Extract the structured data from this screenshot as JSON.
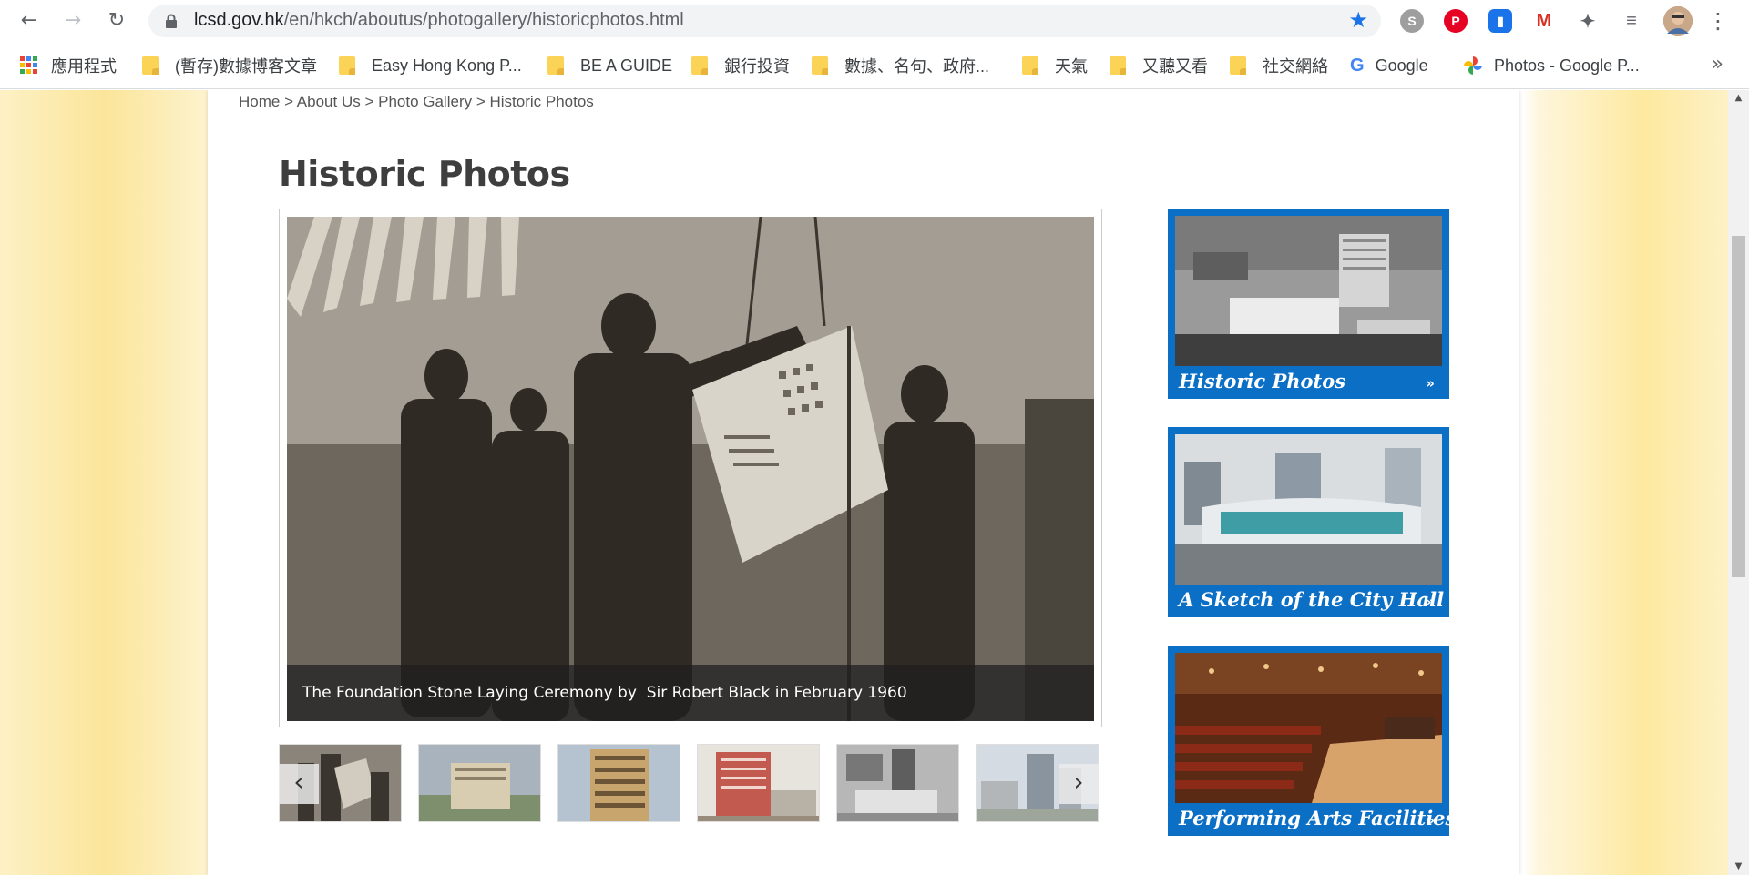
{
  "browser": {
    "url_host": "lcsd.gov.hk",
    "url_path": "/en/hkch/aboutus/photogallery/historicphotos.html",
    "bookmarks": [
      {
        "label": "應用程式",
        "icon": "apps-grid-icon"
      },
      {
        "label": "(暫存)數據博客文章",
        "icon": "folder-icon"
      },
      {
        "label": "Easy Hong Kong P...",
        "icon": "folder-icon"
      },
      {
        "label": "BE A GUIDE",
        "icon": "folder-icon"
      },
      {
        "label": "銀行投資",
        "icon": "folder-icon"
      },
      {
        "label": "數據、名句、政府...",
        "icon": "folder-icon"
      },
      {
        "label": "天氣",
        "icon": "folder-icon"
      },
      {
        "label": "又聽又看",
        "icon": "folder-icon"
      },
      {
        "label": "社交網絡",
        "icon": "folder-icon"
      },
      {
        "label": "Google",
        "icon": "google-icon"
      },
      {
        "label": "Photos - Google P...",
        "icon": "google-photos-icon"
      }
    ]
  },
  "breadcrumb": {
    "home": "Home",
    "sep1": " > ",
    "about": "About Us",
    "sep2": " > ",
    "gallery": "Photo Gallery",
    "sep3": " > ",
    "current": "Historic Photos"
  },
  "page": {
    "title": "Historic Photos",
    "caption": "The Foundation Stone Laying Ceremony by  Sir Robert Black in February 1960"
  },
  "side_links": [
    {
      "label": "Historic Photos",
      "arrow": "»"
    },
    {
      "label": "A Sketch of the City Hall",
      "arrow": "»"
    },
    {
      "label": "Performing Arts Facilities",
      "arrow": "»"
    }
  ],
  "colors": {
    "accent_blue": "#0b6fc6",
    "title_text": "#3e3e3e"
  }
}
